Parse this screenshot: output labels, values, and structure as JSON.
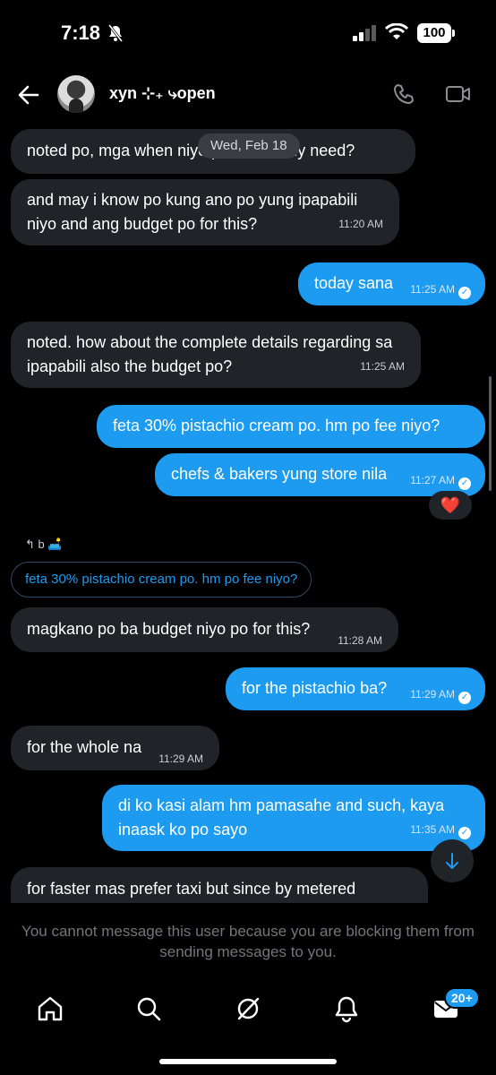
{
  "status_bar": {
    "time": "7:18",
    "battery": "100"
  },
  "header": {
    "contact_name": "xyn ⊹₊ ⤷open"
  },
  "thread": {
    "date_separator": "Wed, Feb 18",
    "messages": [
      {
        "side": "in",
        "text": "noted po, mga when niyo po ito exactly need?",
        "time": ""
      },
      {
        "side": "in",
        "text": "and may i know po kung ano po yung ipapabili niyo and ang budget po for this?",
        "time": "11:20 AM"
      },
      {
        "side": "out",
        "text": "today sana",
        "time": "11:25 AM"
      },
      {
        "side": "in",
        "text": "noted. how about the complete details regarding sa ipapabili also the budget po?",
        "time": "11:25 AM"
      },
      {
        "side": "out",
        "text": "feta 30% pistachio cream po. hm po fee niyo?",
        "time": ""
      },
      {
        "side": "out",
        "text": "chefs & bakers yung store nila",
        "time": "11:27 AM"
      },
      {
        "side": "in",
        "text": "magkano po ba budget niyo po for this?",
        "time": "11:28 AM"
      },
      {
        "side": "out",
        "text": "for the pistachio ba?",
        "time": "11:29 AM"
      },
      {
        "side": "in",
        "text": "for the whole na",
        "time": "11:29 AM"
      },
      {
        "side": "out",
        "text": "di ko kasi alam hm pamasahe and such, kaya inaask ko po sayo",
        "time": "11:35 AM"
      },
      {
        "side": "in",
        "text": "for faster mas prefer taxi but since by metered",
        "time": ""
      }
    ],
    "reaction": "❤️",
    "reply_indicator": "↰ b 🛋️",
    "quoted_text": "feta 30% pistachio cream po. hm po fee niyo?"
  },
  "blocked_notice": "You cannot message this user because you are blocking them from sending messages to you.",
  "nav": {
    "messages_badge": "20+"
  },
  "colors": {
    "accent": "#1d9bf0",
    "incoming_bubble": "#202327",
    "background": "#000000"
  }
}
